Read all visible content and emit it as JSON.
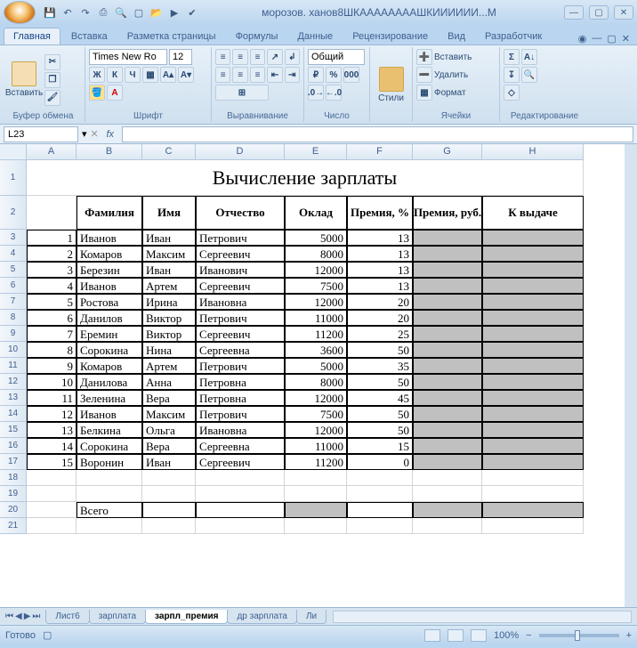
{
  "title": "морозов. ханов8ШКААААААААШКИИИИИИ...M",
  "tabs": [
    "Главная",
    "Вставка",
    "Разметка страницы",
    "Формулы",
    "Данные",
    "Рецензирование",
    "Вид",
    "Разработчик"
  ],
  "activeTab": "Главная",
  "ribbon": {
    "clipboard": {
      "paste": "Вставить",
      "label": "Буфер обмена"
    },
    "font": {
      "name": "Times New Ro",
      "size": "12",
      "label": "Шрифт"
    },
    "alignment": {
      "label": "Выравнивание"
    },
    "number": {
      "format": "Общий",
      "label": "Число"
    },
    "styles": {
      "btn": "Стили",
      "label": ""
    },
    "cells": {
      "insert": "Вставить",
      "delete": "Удалить",
      "format": "Формат",
      "label": "Ячейки"
    },
    "editing": {
      "label": "Редактирование"
    }
  },
  "namebox": "L23",
  "columns": [
    "A",
    "B",
    "C",
    "D",
    "E",
    "F",
    "G",
    "H"
  ],
  "sheetTitle": "Вычисление зарплаты",
  "headers": [
    "",
    "Фамилия",
    "Имя",
    "Отчество",
    "Оклад",
    "Премия, %",
    "Премия, руб.",
    "К выдаче"
  ],
  "rows": [
    {
      "n": "1",
      "fam": "Иванов",
      "im": "Иван",
      "ot": "Петрович",
      "okl": "5000",
      "prem": "13"
    },
    {
      "n": "2",
      "fam": "Комаров",
      "im": "Максим",
      "ot": "Сергеевич",
      "okl": "8000",
      "prem": "13"
    },
    {
      "n": "3",
      "fam": "Березин",
      "im": "Иван",
      "ot": "Иванович",
      "okl": "12000",
      "prem": "13"
    },
    {
      "n": "4",
      "fam": "Иванов",
      "im": "Артем",
      "ot": "Сергеевич",
      "okl": "7500",
      "prem": "13"
    },
    {
      "n": "5",
      "fam": "Ростова",
      "im": "Ирина",
      "ot": "Ивановна",
      "okl": "12000",
      "prem": "20"
    },
    {
      "n": "6",
      "fam": "Данилов",
      "im": "Виктор",
      "ot": "Петрович",
      "okl": "11000",
      "prem": "20"
    },
    {
      "n": "7",
      "fam": "Еремин",
      "im": "Виктор",
      "ot": "Сергеевич",
      "okl": "11200",
      "prem": "25"
    },
    {
      "n": "8",
      "fam": "Сорокина",
      "im": "Нина",
      "ot": "Сергеевна",
      "okl": "3600",
      "prem": "50"
    },
    {
      "n": "9",
      "fam": "Комаров",
      "im": "Артем",
      "ot": "Петрович",
      "okl": "5000",
      "prem": "35"
    },
    {
      "n": "10",
      "fam": "Данилова",
      "im": "Анна",
      "ot": "Петровна",
      "okl": "8000",
      "prem": "50"
    },
    {
      "n": "11",
      "fam": "Зеленина",
      "im": "Вера",
      "ot": "Петровна",
      "okl": "12000",
      "prem": "45"
    },
    {
      "n": "12",
      "fam": "Иванов",
      "im": "Максим",
      "ot": "Петрович",
      "okl": "7500",
      "prem": "50"
    },
    {
      "n": "13",
      "fam": "Белкина",
      "im": "Ольга",
      "ot": "Ивановна",
      "okl": "12000",
      "prem": "50"
    },
    {
      "n": "14",
      "fam": "Сорокина",
      "im": "Вера",
      "ot": "Сергеевна",
      "okl": "11000",
      "prem": "15"
    },
    {
      "n": "15",
      "fam": "Воронин",
      "im": "Иван",
      "ot": "Сергеевич",
      "okl": "11200",
      "prem": "0"
    }
  ],
  "totalLabel": "Всего",
  "sheetTabs": [
    "Лист6",
    "зарплата",
    "зарпл_премия",
    "др зарплата",
    "Ли"
  ],
  "activeSheet": "зарпл_премия",
  "status": {
    "ready": "Готово",
    "zoom": "100%"
  }
}
